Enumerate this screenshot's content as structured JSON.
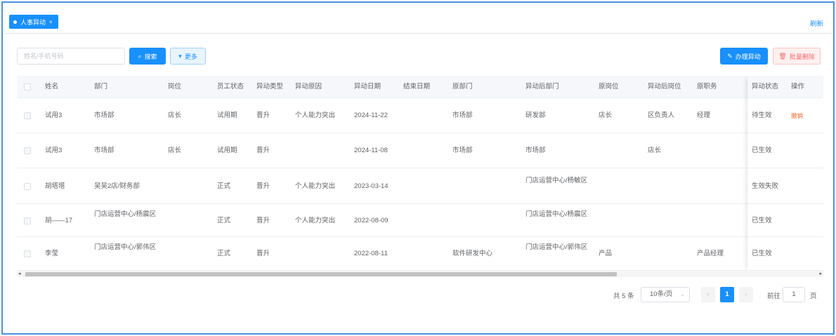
{
  "tabs": [
    {
      "label": "人事异动",
      "close": "×"
    }
  ],
  "header": {
    "refresh_label": "刷新"
  },
  "toolbar": {
    "search_placeholder": "姓名/手机号码",
    "search_label": "搜索",
    "more_label": "更多",
    "handle_label": "办理异动",
    "batch_delete_label": "批量删除"
  },
  "table": {
    "columns": [
      "姓名",
      "部门",
      "岗位",
      "员工状态",
      "异动类型",
      "异动原因",
      "异动日期",
      "结束日期",
      "原部门",
      "异动后部门",
      "原岗位",
      "异动后岗位",
      "原职务",
      "异动状态",
      "操作"
    ],
    "rows": [
      {
        "name": "试用3",
        "dept": "市场部",
        "post": "店长",
        "emp_status": "试用期",
        "type": "晋升",
        "reason": "个人能力突出",
        "date": "2024-11-22",
        "end_date": "",
        "orig_dept": "市场部",
        "new_dept": "研发部",
        "orig_post": "店长",
        "new_post": "区负责人",
        "orig_title": "经理",
        "status": "待生效",
        "action": "撤销"
      },
      {
        "name": "试用3",
        "dept": "市场部",
        "post": "店长",
        "emp_status": "试用期",
        "type": "晋升",
        "reason": "",
        "date": "2024-11-08",
        "end_date": "",
        "orig_dept": "市场部",
        "new_dept": "市场部",
        "orig_post": "",
        "new_post": "店长",
        "orig_title": "",
        "status": "已生效",
        "action": ""
      },
      {
        "name": "胡塔塔",
        "dept": "吴吴2店/财务部",
        "post": "",
        "emp_status": "正式",
        "type": "晋升",
        "reason": "个人能力突出",
        "date": "2023-03-14",
        "end_date": "",
        "orig_dept": "",
        "new_dept": "门店运营中心/杨敏区",
        "orig_post": "",
        "new_post": "",
        "orig_title": "",
        "status": "生效失败",
        "action": ""
      },
      {
        "name": "胡——17",
        "dept": "门店运营中心/杨震区",
        "post": "",
        "emp_status": "正式",
        "type": "晋升",
        "reason": "个人能力突出",
        "date": "2022-08-09",
        "end_date": "",
        "orig_dept": "",
        "new_dept": "门店运营中心/杨震区",
        "orig_post": "",
        "new_post": "",
        "orig_title": "",
        "status": "已生效",
        "action": ""
      },
      {
        "name": "李莹",
        "dept": "门店运营中心/郭伟区",
        "post": "",
        "emp_status": "正式",
        "type": "晋升",
        "reason": "",
        "date": "2022-08-11",
        "end_date": "",
        "orig_dept": "软件研发中心",
        "new_dept": "门店运营中心/郭伟区",
        "orig_post": "产品",
        "new_post": "",
        "orig_title": "产品经理",
        "status": "已生效",
        "action": ""
      }
    ]
  },
  "pagination": {
    "total_label": "共 5 条",
    "page_size_label": "10条/页",
    "current_page": "1",
    "goto_label": "前往",
    "goto_value": "1",
    "page_suffix": "页"
  },
  "colors": {
    "primary": "#1890ff",
    "danger": "#f56c6c",
    "revoke": "#e86a2a"
  }
}
